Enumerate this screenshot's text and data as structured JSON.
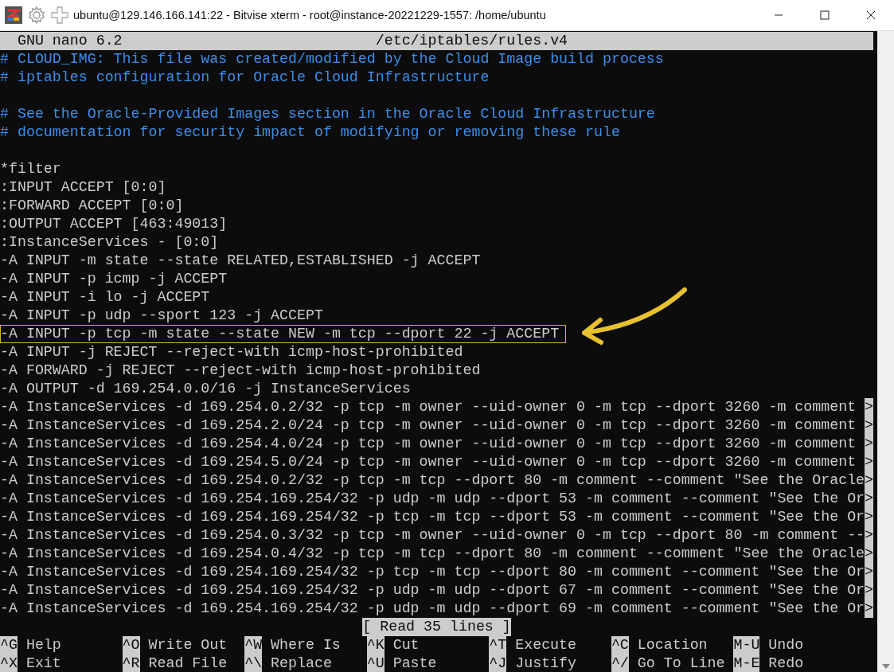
{
  "window": {
    "title": "ubuntu@129.146.166.141:22 - Bitvise xterm - root@instance-20221229-1557: /home/ubuntu"
  },
  "editor": {
    "app": "GNU nano 6.2",
    "file": "/etc/iptables/rules.v4"
  },
  "lines": [
    {
      "kind": "comment",
      "text": "# CLOUD_IMG: This file was created/modified by the Cloud Image build process"
    },
    {
      "kind": "comment",
      "text": "# iptables configuration for Oracle Cloud Infrastructure"
    },
    {
      "kind": "blank"
    },
    {
      "kind": "comment",
      "text": "# See the Oracle-Provided Images section in the Oracle Cloud Infrastructure"
    },
    {
      "kind": "comment",
      "text": "# documentation for security impact of modifying or removing these rule"
    },
    {
      "kind": "blank"
    },
    {
      "kind": "text",
      "text": "*filter"
    },
    {
      "kind": "text",
      "text": ":INPUT ACCEPT [0:0]"
    },
    {
      "kind": "text",
      "text": ":FORWARD ACCEPT [0:0]"
    },
    {
      "kind": "text",
      "text": ":OUTPUT ACCEPT [463:49013]"
    },
    {
      "kind": "text",
      "text": ":InstanceServices - [0:0]"
    },
    {
      "kind": "text",
      "text": "-A INPUT -m state --state RELATED,ESTABLISHED -j ACCEPT"
    },
    {
      "kind": "text",
      "text": "-A INPUT -p icmp -j ACCEPT"
    },
    {
      "kind": "text",
      "text": "-A INPUT -i lo -j ACCEPT"
    },
    {
      "kind": "text",
      "text": "-A INPUT -p udp --sport 123 -j ACCEPT"
    },
    {
      "kind": "text",
      "text": "-A INPUT -p tcp -m state --state NEW -m tcp --dport 22 -j ACCEPT",
      "highlighted": true
    },
    {
      "kind": "text",
      "text": "-A INPUT -j REJECT --reject-with icmp-host-prohibited"
    },
    {
      "kind": "text",
      "text": "-A FORWARD -j REJECT --reject-with icmp-host-prohibited"
    },
    {
      "kind": "text",
      "text": "-A OUTPUT -d 169.254.0.0/16 -j InstanceServices"
    },
    {
      "kind": "text",
      "text": "-A InstanceServices -d 169.254.0.2/32 -p tcp -m owner --uid-owner 0 -m tcp --dport 3260 -m comment",
      "cut_marker": ">"
    },
    {
      "kind": "text",
      "text": "-A InstanceServices -d 169.254.2.0/24 -p tcp -m owner --uid-owner 0 -m tcp --dport 3260 -m comment",
      "cut_marker": ">"
    },
    {
      "kind": "text",
      "text": "-A InstanceServices -d 169.254.4.0/24 -p tcp -m owner --uid-owner 0 -m tcp --dport 3260 -m comment",
      "cut_marker": ">"
    },
    {
      "kind": "text",
      "text": "-A InstanceServices -d 169.254.5.0/24 -p tcp -m owner --uid-owner 0 -m tcp --dport 3260 -m comment",
      "cut_marker": ">"
    },
    {
      "kind": "text",
      "text": "-A InstanceServices -d 169.254.0.2/32 -p tcp -m tcp --dport 80 -m comment --comment \"See the Oracle",
      "cut_marker": ">"
    },
    {
      "kind": "text",
      "text": "-A InstanceServices -d 169.254.169.254/32 -p udp -m udp --dport 53 -m comment --comment \"See the Or",
      "cut_marker": ">"
    },
    {
      "kind": "text",
      "text": "-A InstanceServices -d 169.254.169.254/32 -p tcp -m tcp --dport 53 -m comment --comment \"See the Or",
      "cut_marker": ">"
    },
    {
      "kind": "text",
      "text": "-A InstanceServices -d 169.254.0.3/32 -p tcp -m owner --uid-owner 0 -m tcp --dport 80 -m comment --",
      "cut_marker": ">"
    },
    {
      "kind": "text",
      "text": "-A InstanceServices -d 169.254.0.4/32 -p tcp -m tcp --dport 80 -m comment --comment \"See the Oracle",
      "cut_marker": ">"
    },
    {
      "kind": "text",
      "text": "-A InstanceServices -d 169.254.169.254/32 -p tcp -m tcp --dport 80 -m comment --comment \"See the Or",
      "cut_marker": ">"
    },
    {
      "kind": "text",
      "text": "-A InstanceServices -d 169.254.169.254/32 -p udp -m udp --dport 67 -m comment --comment \"See the Or",
      "cut_marker": ">"
    },
    {
      "kind": "text",
      "text": "-A InstanceServices -d 169.254.169.254/32 -p udp -m udp --dport 69 -m comment --comment \"See the Or",
      "cut_marker": ">"
    }
  ],
  "status": "[ Read 35 lines ]",
  "shortcuts": [
    [
      {
        "key": "^G",
        "label": "Help"
      },
      {
        "key": "^O",
        "label": "Write Out"
      },
      {
        "key": "^W",
        "label": "Where Is"
      },
      {
        "key": "^K",
        "label": "Cut"
      },
      {
        "key": "^T",
        "label": "Execute"
      },
      {
        "key": "^C",
        "label": "Location"
      },
      {
        "key": "M-U",
        "label": "Undo"
      }
    ],
    [
      {
        "key": "^X",
        "label": "Exit"
      },
      {
        "key": "^R",
        "label": "Read File"
      },
      {
        "key": "^\\",
        "label": "Replace"
      },
      {
        "key": "^U",
        "label": "Paste"
      },
      {
        "key": "^J",
        "label": "Justify"
      },
      {
        "key": "^/",
        "label": "Go To Line"
      },
      {
        "key": "M-E",
        "label": "Redo"
      }
    ]
  ]
}
